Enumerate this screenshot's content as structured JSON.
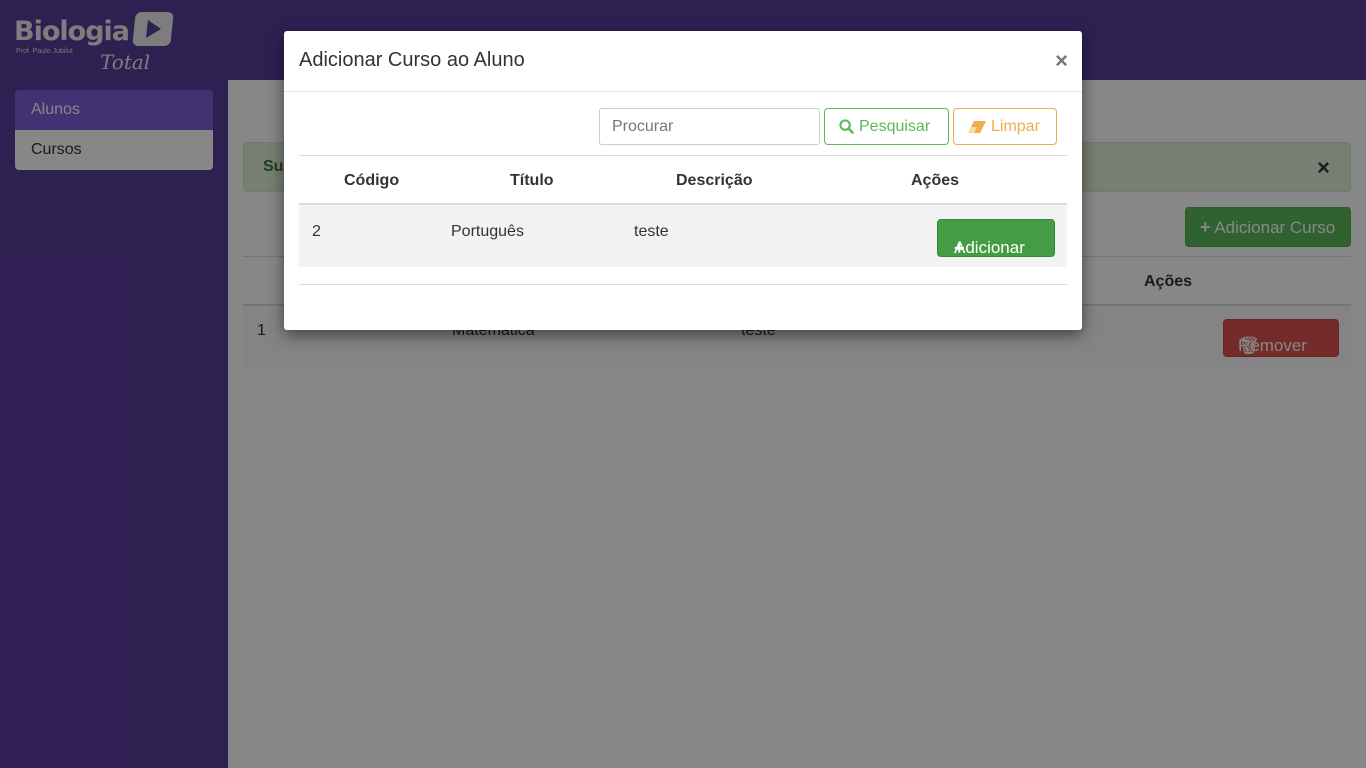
{
  "brand": {
    "name": "Biologia",
    "tagline": "Prof. Paulo Jubilut",
    "script": "Total"
  },
  "sidebar": {
    "items": [
      {
        "label": "Alunos"
      },
      {
        "label": "Cursos"
      }
    ]
  },
  "main": {
    "alert_text": "Sucesso!",
    "alert_close": "×",
    "add_course_label": "Adicionar Curso",
    "table": {
      "actions_header": "Ações",
      "rows": [
        {
          "codigo": "1",
          "titulo": "Matemática",
          "descricao": "teste",
          "action_label": "Remover"
        }
      ]
    }
  },
  "modal": {
    "title": "Adicionar Curso ao Aluno",
    "close": "×",
    "search_placeholder": "Procurar",
    "search_button": "Pesquisar",
    "clear_button": "Limpar",
    "columns": [
      "Código",
      "Título",
      "Descrição",
      "Ações"
    ],
    "rows": [
      {
        "codigo": "2",
        "titulo": "Português",
        "descricao": "teste",
        "action_label": "Adicionar"
      }
    ]
  },
  "colors": {
    "brand_purple": "#5a3d9c",
    "active_nav": "#7e5ed9",
    "success": "#5cb85c",
    "warning": "#f0ad4e",
    "danger": "#d9534f"
  }
}
